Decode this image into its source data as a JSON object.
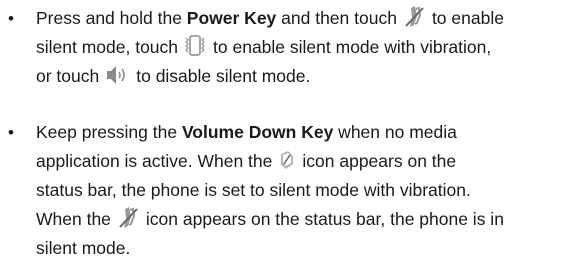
{
  "items": [
    {
      "bullet": "•",
      "l1_a": "Press and hold the ",
      "l1_b": "Power Key",
      "l1_c": " and then touch",
      "l1_d": "to enable",
      "l2_a": "silent mode, touch",
      "l2_b": "to enable silent mode with vibration,",
      "l3_a": "or touch",
      "l3_b": "to disable silent mode."
    },
    {
      "bullet": "•",
      "l1_a": "Keep pressing the ",
      "l1_b": "Volume Down Key",
      "l1_c": " when no media",
      "l2_a": "application is active. When the",
      "l2_b": "icon appears on the",
      "l3": "status bar, the phone is set to silent mode with vibration.",
      "l4_a": "When the",
      "l4_b": "icon appears on the status bar, the phone is in",
      "l5": "silent mode."
    }
  ],
  "icons": {
    "silent": "silent-mode-icon",
    "vibrate": "vibrate-mode-icon",
    "sound_on": "sound-on-icon",
    "vibrate_status": "vibrate-status-icon"
  },
  "colors": {
    "text": "#1a1a1a",
    "icon_gray": "#9a9a9a",
    "icon_dark": "#555555"
  }
}
